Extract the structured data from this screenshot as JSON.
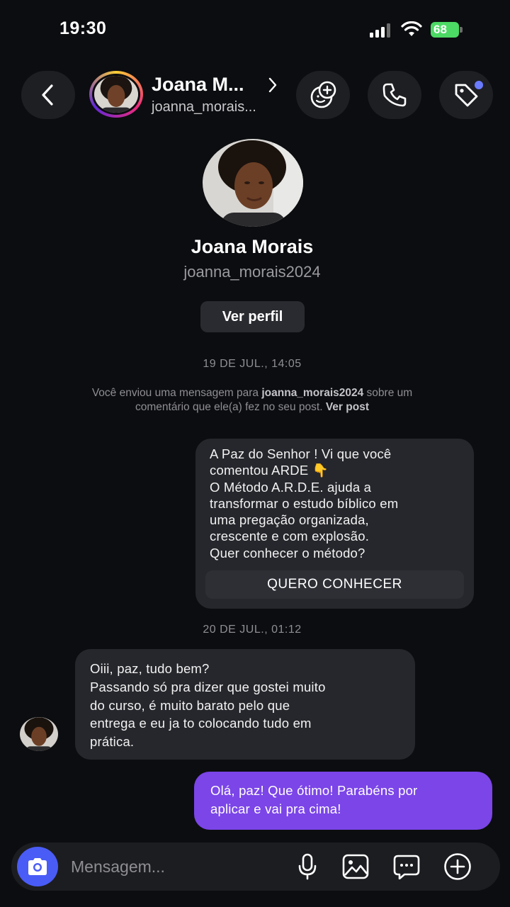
{
  "status_bar": {
    "time": "19:30",
    "battery": "68"
  },
  "header": {
    "name": "Joana M...",
    "username": "joanna_morais..."
  },
  "profile": {
    "name": "Joana Morais",
    "username": "joanna_morais2024",
    "view_profile_label": "Ver perfil"
  },
  "thread": {
    "date1": "19 DE JUL., 14:05",
    "system_note_prefix": "Você enviou uma mensagem para ",
    "system_note_user": "joanna_morais2024",
    "system_note_middle": " sobre um comentário que ele(a) fez no seu post. ",
    "system_note_link": "Ver post",
    "outgoing_card": {
      "text": "A Paz do Senhor ! Vi que você\ncomentou ARDE 👇\nO Método A.R.D.E. ajuda a\ntransformar o estudo bíblico em\numa pregação organizada,\ncrescente e com explosão.\nQuer conhecer o método?",
      "button_label": "QUERO CONHECER"
    },
    "date2": "20 DE JUL., 01:12",
    "incoming": {
      "text": "Oiii, paz, tudo bem?\nPassando só pra dizer que gostei muito\ndo curso, é muito barato pelo que\nentrega e eu ja to colocando tudo em\nprática."
    },
    "outgoing": {
      "text": "Olá, paz! Que ótimo! Parabéns por\naplicar e vai pra cima!"
    }
  },
  "composer": {
    "placeholder": "Mensagem..."
  },
  "colors": {
    "background": "#0c0d10",
    "bubble_gray": "#26272c",
    "bubble_mine": "#7b45e8",
    "camera_button": "#4a5cf6",
    "battery": "#4cd964"
  },
  "icons": [
    "signal-icon",
    "wifi-icon",
    "battery-icon",
    "back-icon",
    "chevron-right-icon",
    "effects-icon",
    "phone-icon",
    "tag-icon",
    "camera-icon",
    "mic-icon",
    "gallery-icon",
    "sticker-icon",
    "plus-icon"
  ]
}
